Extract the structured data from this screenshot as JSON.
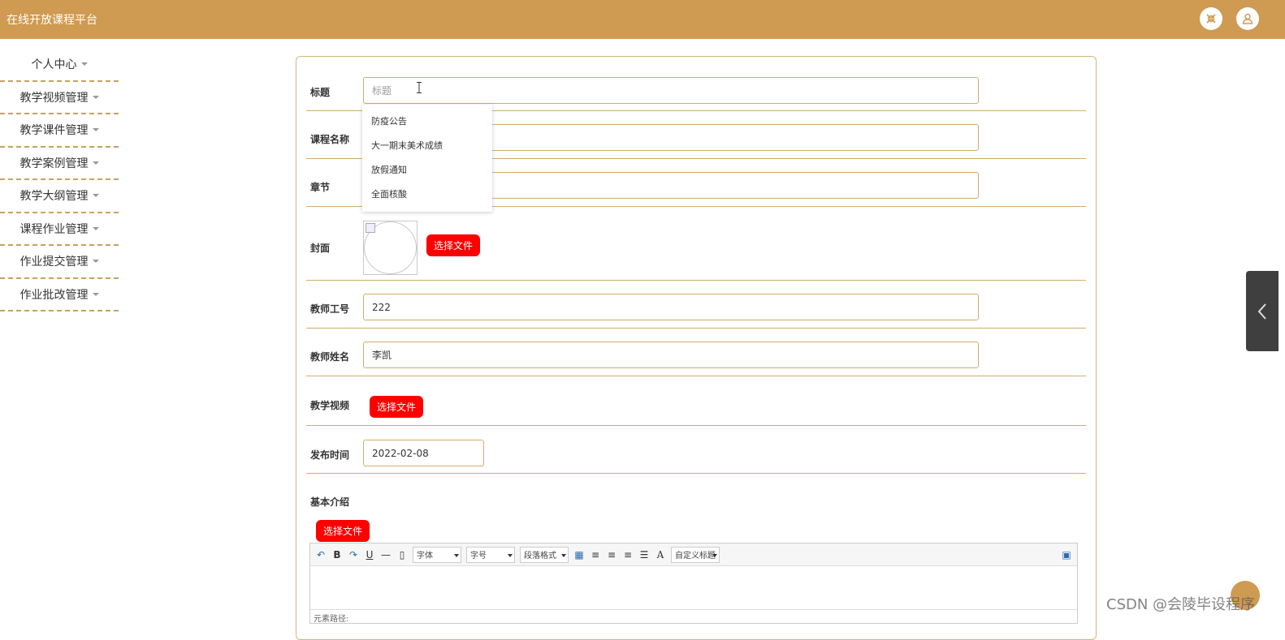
{
  "header": {
    "app_title": "在线开放课程平台",
    "fullscreen_icon": "fullscreen-exit-icon",
    "user_icon": "user-icon"
  },
  "sidebar": {
    "items": [
      {
        "label": "个人中心"
      },
      {
        "label": "教学视频管理"
      },
      {
        "label": "教学课件管理"
      },
      {
        "label": "教学案例管理"
      },
      {
        "label": "教学大纲管理"
      },
      {
        "label": "课程作业管理"
      },
      {
        "label": "作业提交管理"
      },
      {
        "label": "作业批改管理"
      }
    ]
  },
  "form": {
    "title_label": "标题",
    "title_placeholder": "标题",
    "course_label": "课程名称",
    "chapter_label": "章节",
    "cover_label": "封面",
    "cover_button": "选择文件",
    "teacher_id_label": "教师工号",
    "teacher_id_value": "222",
    "teacher_name_label": "教师姓名",
    "teacher_name_value": "李凯",
    "video_label": "教学视频",
    "video_button": "选择文件",
    "publish_label": "发布时间",
    "publish_value": "2022-02-08",
    "intro_label": "基本介绍",
    "intro_button": "选择文件"
  },
  "autocomplete": {
    "items": [
      "防疫公告",
      "大一期末美术成绩",
      "放假通知",
      "全面核酸"
    ]
  },
  "editor": {
    "font_select": "字体",
    "size_select": "字号",
    "para_select": "段落格式",
    "custom_select": "自定义标题",
    "path_label": "元素路径:"
  },
  "watermark": "CSDN @会陵毕设程序",
  "colors": {
    "primary": "#cf9a51",
    "button_red": "#ff0000",
    "border": "#d2ac6c"
  }
}
